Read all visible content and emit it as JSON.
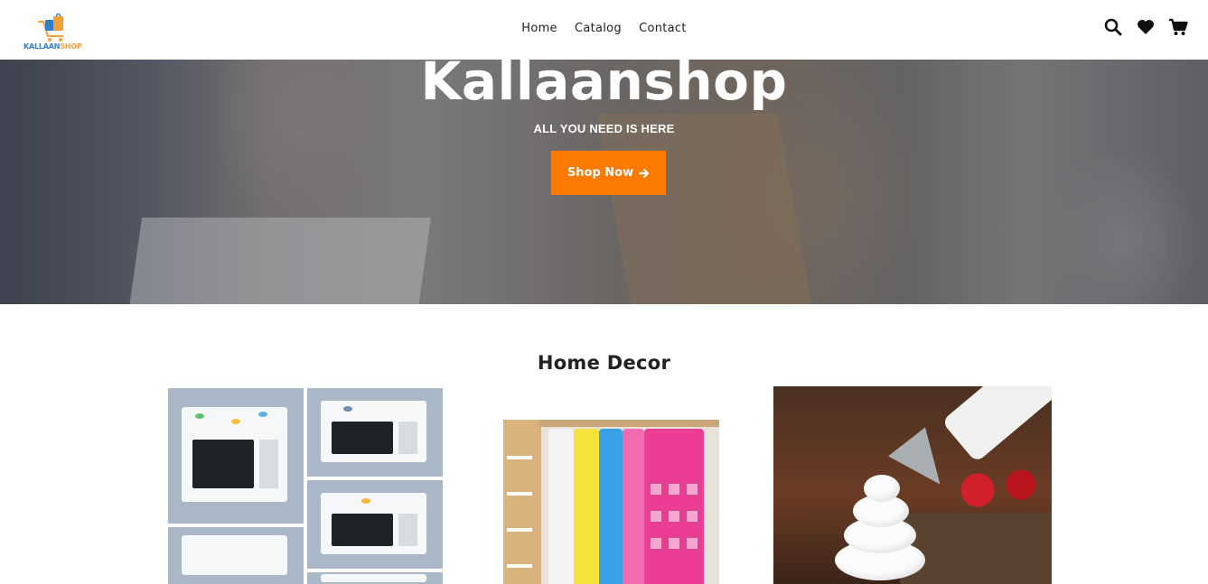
{
  "header": {
    "logo": {
      "part1": "KALLAAN",
      "part2": "SHOP"
    },
    "nav": [
      {
        "label": "Home"
      },
      {
        "label": "Catalog"
      },
      {
        "label": "Contact"
      }
    ],
    "icons": [
      "search-icon",
      "heart-icon",
      "cart-icon"
    ]
  },
  "hero": {
    "title": "Kallaanshop",
    "subtitle": "ALL YOU NEED IS HERE",
    "button_label": "Shop Now",
    "button_color": "#fc7a02"
  },
  "section": {
    "title": "Home Decor",
    "products": [
      {
        "image": "microwave-cover-collage"
      },
      {
        "image": "wardrobe-hanging-organizer"
      },
      {
        "image": "cupcake-piping-nozzle"
      }
    ]
  },
  "colors": {
    "accent": "#fc7a02",
    "logo_blue": "#2f7fc9",
    "logo_orange": "#f5a03a"
  }
}
